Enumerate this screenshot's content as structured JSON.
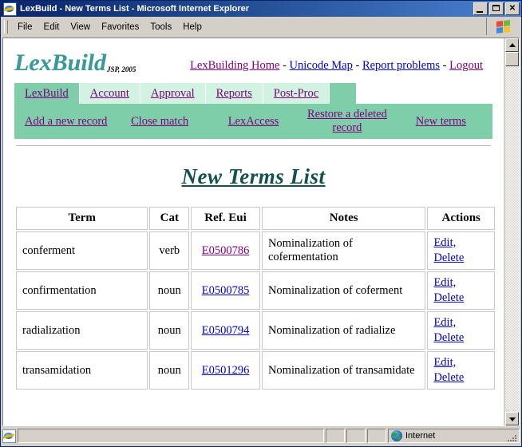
{
  "window": {
    "title": "LexBuild - New Terms List - Microsoft Internet Explorer",
    "app_icon": "ie-document-icon",
    "minimize_label": "_",
    "maximize_label": "",
    "close_label": "✕"
  },
  "menubar": {
    "items": [
      "File",
      "Edit",
      "View",
      "Favorites",
      "Tools",
      "Help"
    ],
    "brand_icon": "windows-flag-icon"
  },
  "header": {
    "logo": "LexBuild",
    "logo_sub": "JSP, 2005",
    "links": [
      {
        "label": "LexBuilding Home",
        "state": "visited"
      },
      {
        "label": "Unicode Map",
        "state": "normal"
      },
      {
        "label": "Report problems",
        "state": "normal"
      },
      {
        "label": "Logout",
        "state": "visited"
      }
    ],
    "separator": "-"
  },
  "nav": {
    "tabs": [
      {
        "label": "LexBuild",
        "active": true
      },
      {
        "label": "Account",
        "active": false
      },
      {
        "label": "Approval",
        "active": false
      },
      {
        "label": "Reports",
        "active": false
      },
      {
        "label": "Post-Proc",
        "active": false
      }
    ],
    "subnav": [
      "Add a new record",
      "Close match",
      "LexAccess",
      "Restore a deleted record",
      "New terms"
    ]
  },
  "main": {
    "page_title": "New Terms List",
    "table": {
      "columns": [
        "Term",
        "Cat",
        "Ref. Eui",
        "Notes",
        "Actions"
      ],
      "rows": [
        {
          "term": "conferment",
          "cat": "verb",
          "eui": "E0500786",
          "eui_state": "visited",
          "notes": "Nominalization of cofermentation",
          "edit": "Edit,",
          "delete": "Delete"
        },
        {
          "term": "confirmentation",
          "cat": "noun",
          "eui": "E0500785",
          "eui_state": "normal",
          "notes": "Nominalization of coferment",
          "edit": "Edit,",
          "delete": "Delete"
        },
        {
          "term": "radialization",
          "cat": "noun",
          "eui": "E0500794",
          "eui_state": "normal",
          "notes": "Nominalization of radialize",
          "edit": "Edit,",
          "delete": "Delete"
        },
        {
          "term": "transamidation",
          "cat": "noun",
          "eui": "E0501296",
          "eui_state": "normal",
          "notes": "Nominalization of transamidate",
          "edit": "Edit,",
          "delete": "Delete"
        }
      ]
    }
  },
  "statusbar": {
    "message": "",
    "zone": "Internet",
    "zone_icon": "globe-icon",
    "left_icon": "ie-icon"
  },
  "colors": {
    "titlebar": "#0a246a",
    "nav_green": "#7fceaa",
    "nav_green_light": "#d2f2e2",
    "logo_teal": "#3a9a9a",
    "title_teal": "#13504f",
    "link_visited": "#800080",
    "link_normal": "#0000cc"
  }
}
